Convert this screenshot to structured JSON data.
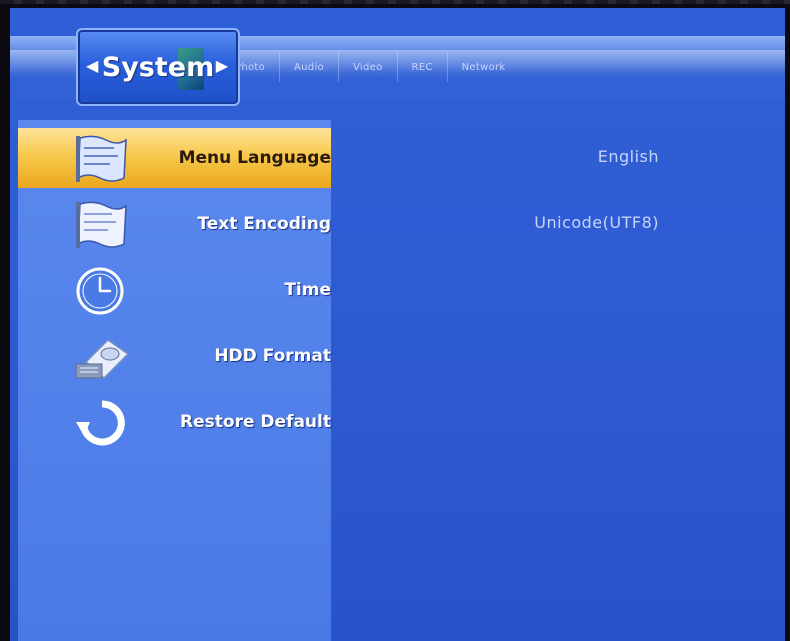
{
  "header": {
    "active_tab": "System",
    "tabs": [
      "Photo",
      "Audio",
      "Video",
      "REC",
      "Network"
    ]
  },
  "menu": [
    {
      "label": "Menu Language",
      "icon": "language-flag-icon",
      "selected": true,
      "value": "English"
    },
    {
      "label": "Text Encoding",
      "icon": "encoding-flag-icon",
      "selected": false,
      "value": "Unicode(UTF8)"
    },
    {
      "label": "Time",
      "icon": "clock-icon",
      "selected": false,
      "value": ""
    },
    {
      "label": "HDD Format",
      "icon": "hdd-icon",
      "selected": false,
      "value": ""
    },
    {
      "label": "Restore Default",
      "icon": "restore-arrow-icon",
      "selected": false,
      "value": ""
    }
  ],
  "colors": {
    "background_blue": "#2f5cd3",
    "panel_blue": "#4a7ae6",
    "selection_gold": "#f8c94d"
  }
}
